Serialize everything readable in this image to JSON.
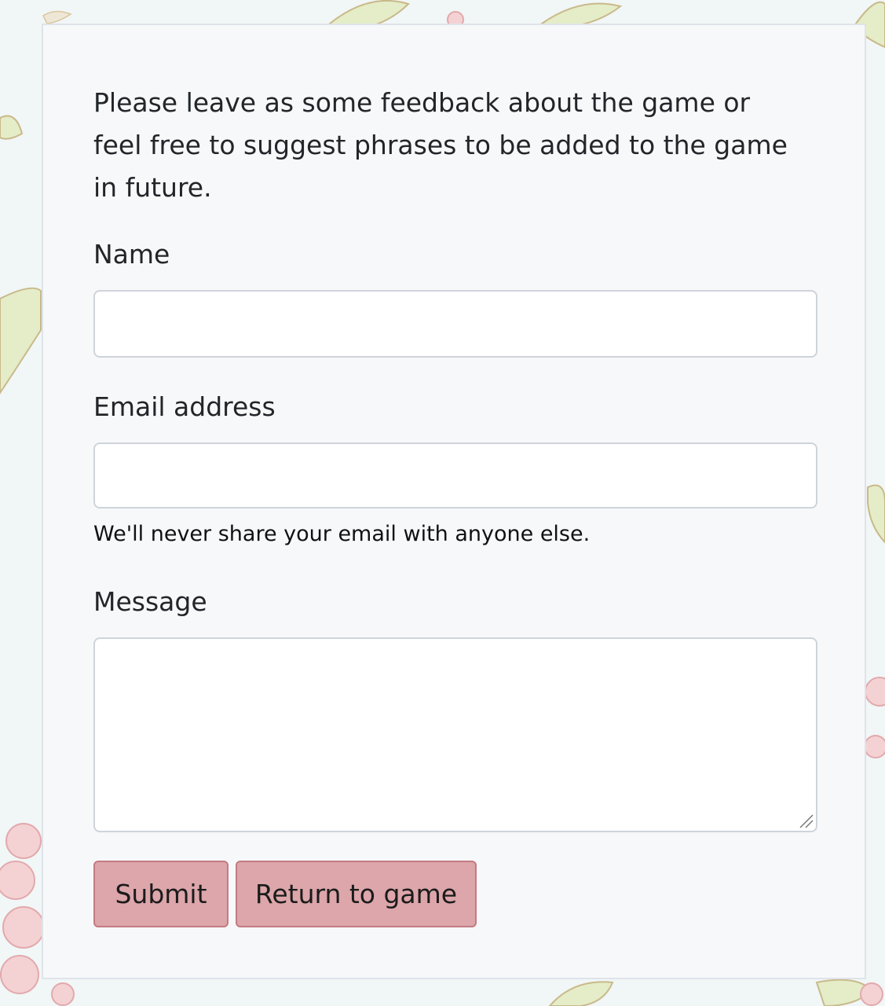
{
  "form": {
    "intro": "Please leave as some feedback about the game or feel free to suggest phrases to be added to the game in future.",
    "name_label": "Name",
    "name_value": "",
    "email_label": "Email address",
    "email_value": "",
    "email_help": "We'll never share your email with anyone else.",
    "message_label": "Message",
    "message_value": "",
    "submit_label": "Submit",
    "return_label": "Return to game"
  },
  "colors": {
    "page_background": "#f1f6f6",
    "card_background": "#f7f8f9",
    "button_background": "#dca6aa",
    "button_border": "#c47b83",
    "text": "#222529"
  },
  "background_decor": [
    "leaf-icon",
    "flower-icon"
  ]
}
